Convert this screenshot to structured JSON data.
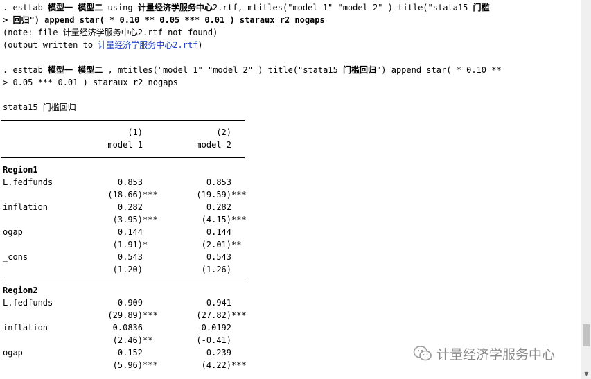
{
  "console": {
    "cmd1_line1": {
      "p1": ". esttab ",
      "p2": "模型一 模型二",
      "p3": " using ",
      "p4": "计量经济学服务中心",
      "p5": "2.rtf, mtitles(\"model 1\" \"model 2\" ) title(\"stata15 ",
      "p6": "门槛"
    },
    "cmd1_line2": {
      "p1": "> ",
      "p2": "回归",
      "p3": "\") append star( * 0.10 ** 0.05 *** 0.01 ) staraux r2 nogaps"
    },
    "note_line": {
      "p1": "(note: file ",
      "p2": "计量经济学服务中心",
      "p3": "2.rtf not found)"
    },
    "output_line": {
      "p1": "(output written to ",
      "p2": "计量经济学服务中心2.rtf",
      "p3": ")"
    },
    "cmd2_line1": {
      "p1": ". esttab ",
      "p2": "模型一 模型二",
      "p3": " , mtitles(\"model 1\" \"model 2\" ) title(\"stata15 ",
      "p4": "门槛回归",
      "p5": "\") append star( * 0.10 **"
    },
    "cmd2_line2": {
      "p1": "> 0.05 *** 0.01 ) staraux r2 nogaps"
    }
  },
  "table": {
    "title": "stata15 门槛回归",
    "col_nums": [
      "(1)",
      "(2)"
    ],
    "col_titles": [
      "model 1",
      "model 2"
    ],
    "sections": [
      {
        "name": "Region1",
        "rows": [
          {
            "label": "L.fedfunds",
            "v1": "0.853",
            "v2": "0.853",
            "t1": "(18.66)",
            "s1": "***",
            "t2": "(19.59)",
            "s2": "***"
          },
          {
            "label": "inflation",
            "v1": "0.282",
            "v2": "0.282",
            "t1": "(3.95)",
            "s1": "***",
            "t2": "(4.15)",
            "s2": "***"
          },
          {
            "label": "ogap",
            "v1": "0.144",
            "v2": "0.144",
            "t1": "(1.91)",
            "s1": "*",
            "t2": "(2.01)",
            "s2": "**"
          },
          {
            "label": "_cons",
            "v1": "0.543",
            "v2": "0.543",
            "t1": "(1.20)",
            "s1": "",
            "t2": "(1.26)",
            "s2": ""
          }
        ]
      },
      {
        "name": "Region2",
        "rows": [
          {
            "label": "L.fedfunds",
            "v1": "0.909",
            "v2": "0.941",
            "t1": "(29.89)",
            "s1": "***",
            "t2": "(27.82)",
            "s2": "***"
          },
          {
            "label": "inflation",
            "v1": "0.0836",
            "v2": "-0.0192",
            "t1": "(2.46)",
            "s1": "**",
            "t2": "(-0.41)",
            "s2": ""
          },
          {
            "label": "ogap",
            "v1": "0.152",
            "v2": "0.239",
            "t1": "(5.96)",
            "s1": "***",
            "t2": "(4.22)",
            "s2": "***"
          }
        ]
      }
    ]
  },
  "watermark": {
    "text": "计量经济学服务中心",
    "icon": "wechat-icon"
  },
  "scrollbar": {
    "down_arrow": "▼"
  }
}
